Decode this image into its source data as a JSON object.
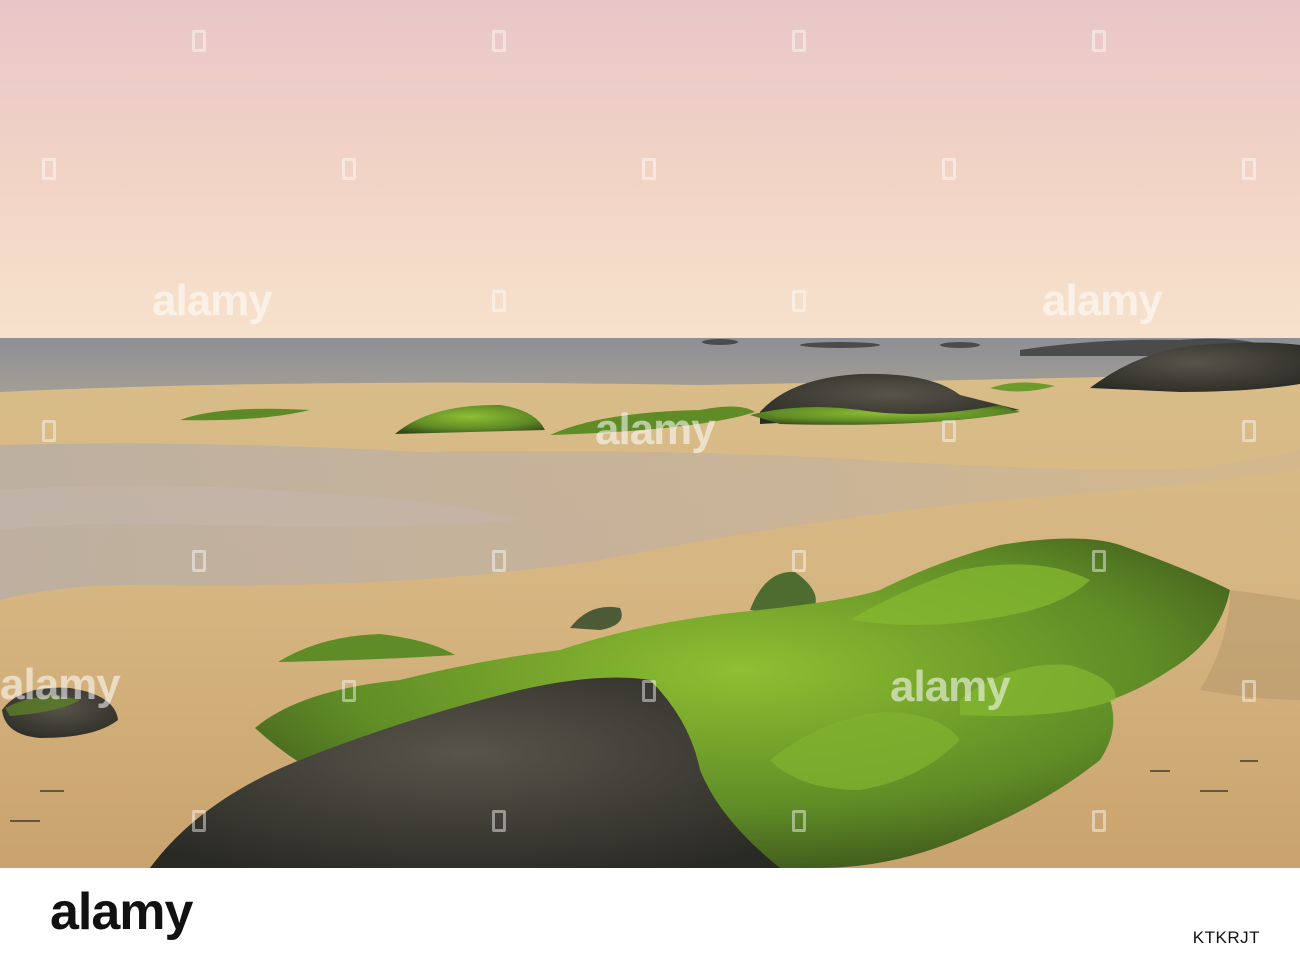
{
  "watermark": {
    "text": "alamy"
  },
  "footer": {
    "logo": "alamy",
    "image_id": "KTKRJT"
  },
  "colors": {
    "sky_top": "#ebc8c3",
    "sky_horizon": "#f5dcc8",
    "sea": "#8a8f94",
    "sand": "#d7b884",
    "wet_sand": "#b8a89a",
    "moss": "#6e9a2c",
    "rock": "#3a3a2e"
  }
}
